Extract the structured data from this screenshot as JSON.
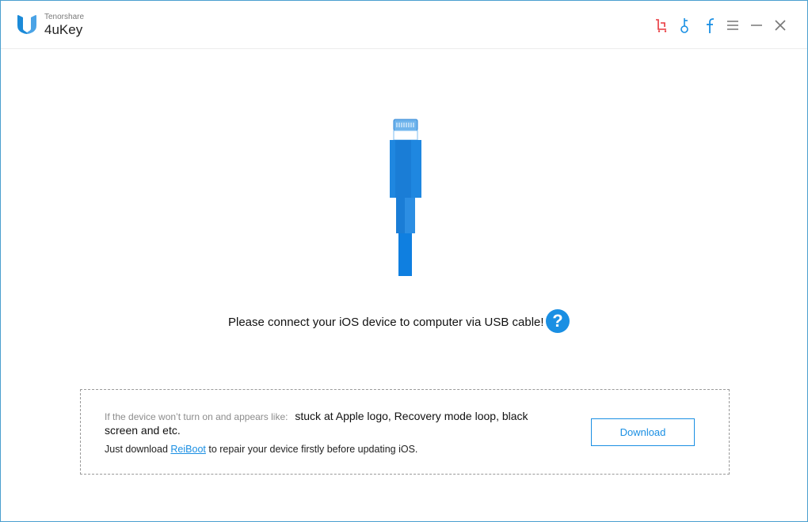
{
  "app": {
    "vendor": "Tenorshare",
    "name": "4uKey"
  },
  "titlebar": {
    "icons": [
      "cart-icon",
      "key-icon",
      "facebook-icon",
      "menu-icon",
      "minimize-icon",
      "close-icon"
    ]
  },
  "main": {
    "prompt": "Please connect your iOS device to computer via USB cable!",
    "help_label": "?"
  },
  "notice": {
    "intro": "If the device won’t turn on and appears like:",
    "symptoms": "stuck at Apple logo, Recovery mode loop, black screen and etc.",
    "download_prefix": "Just download",
    "reiboot_link": "ReiBoot",
    "download_suffix": "to repair your device firstly before updating iOS.",
    "download_button": "Download"
  },
  "colors": {
    "accent": "#1a8fe3",
    "cart": "#e8353b",
    "border": "#4a9fcf"
  }
}
